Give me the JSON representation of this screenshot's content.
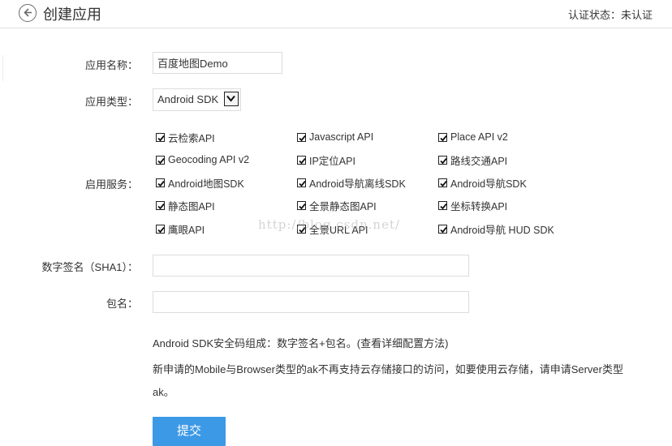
{
  "header": {
    "title": "创建应用",
    "back_icon": "arrow-left-circle-icon",
    "cert_label": "认证状态：",
    "cert_value": "未认证"
  },
  "form": {
    "app_name": {
      "label": "应用名称：",
      "value": "百度地图Demo"
    },
    "app_type": {
      "label": "应用类型：",
      "value": "Android SDK",
      "options": [
        "Android SDK"
      ]
    },
    "services": {
      "label": "启用服务：",
      "items": [
        {
          "label": "云检索API",
          "checked": true
        },
        {
          "label": "Javascript API",
          "checked": true
        },
        {
          "label": "Place API v2",
          "checked": true
        },
        {
          "label": "Geocoding API v2",
          "checked": true
        },
        {
          "label": "IP定位API",
          "checked": true
        },
        {
          "label": "路线交通API",
          "checked": true
        },
        {
          "label": "Android地图SDK",
          "checked": true
        },
        {
          "label": "Android导航离线SDK",
          "checked": true
        },
        {
          "label": "Android导航SDK",
          "checked": true
        },
        {
          "label": "静态图API",
          "checked": true
        },
        {
          "label": "全景静态图API",
          "checked": true
        },
        {
          "label": "坐标转换API",
          "checked": true
        },
        {
          "label": "鹰眼API",
          "checked": true
        },
        {
          "label": "全景URL API",
          "checked": true
        },
        {
          "label": "Android导航 HUD SDK",
          "checked": true
        }
      ]
    },
    "sha1": {
      "label": "数字签名（SHA1）：",
      "value": ""
    },
    "package": {
      "label": "包名：",
      "value": ""
    },
    "notes": {
      "line1_text": "Android SDK安全码组成：数字签名+包名。",
      "line1_link": "(查看详细配置方法)",
      "line2": "新申请的Mobile与Browser类型的ak不再支持云存储接口的访问，如要使用云存储，请申请Server类型",
      "line3": "ak。"
    },
    "submit_label": "提交"
  },
  "watermark": "http://blog.csdn.net/"
}
